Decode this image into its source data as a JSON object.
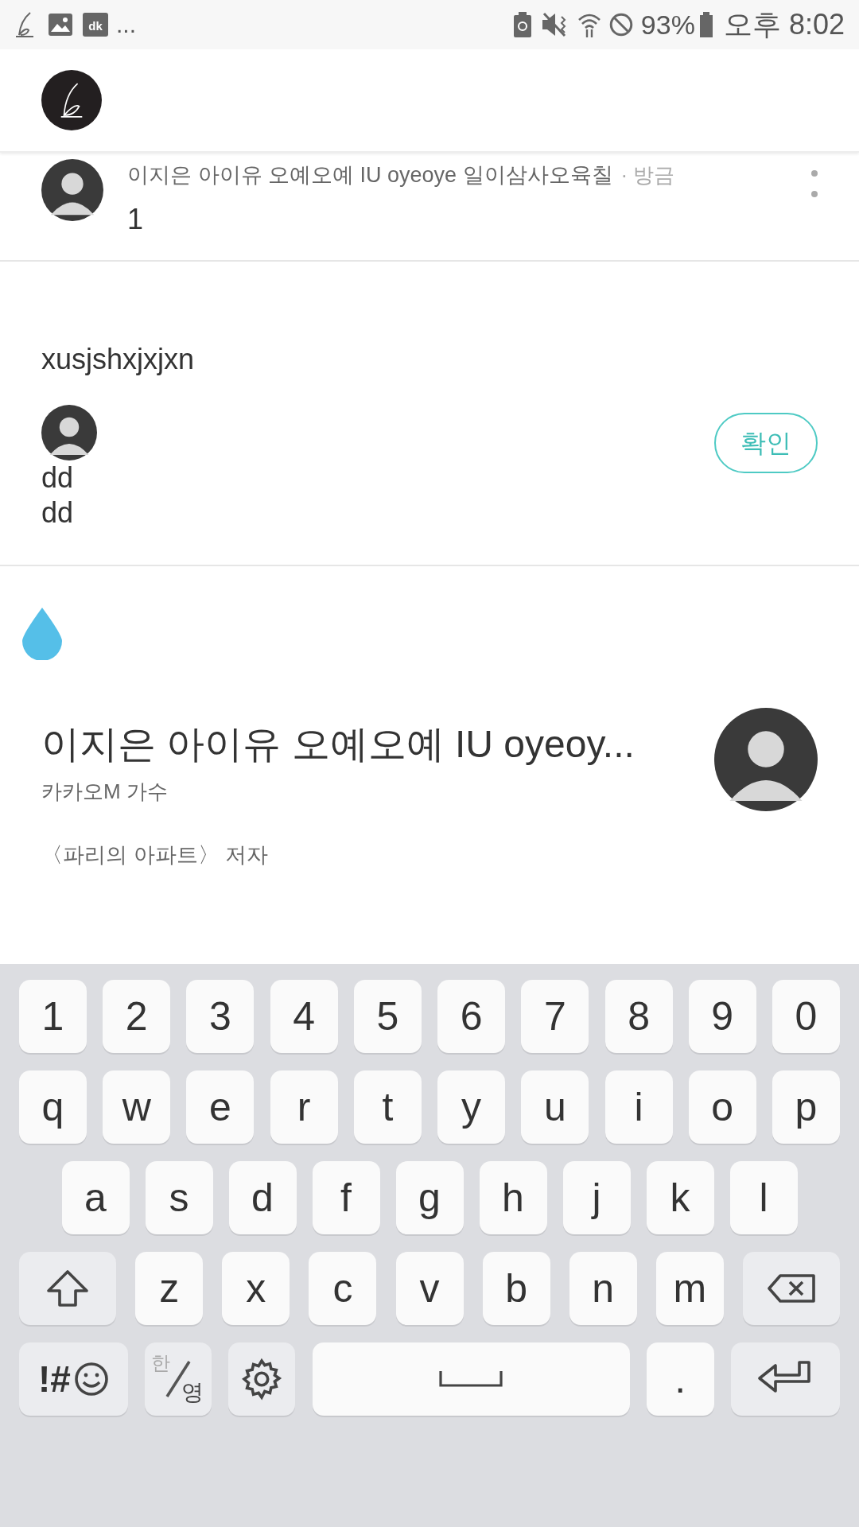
{
  "status_bar": {
    "notification_badge": "dk",
    "more": "...",
    "battery_percent": "93%",
    "time": "오후 8:02"
  },
  "comment": {
    "author": "이지은 아이유 오예오예 IU oyeoye 일이삼사오육칠",
    "time": "· 방금",
    "text": "1"
  },
  "draft": {
    "text": "xusjshxjxjxn"
  },
  "reply": {
    "lines": [
      "dd",
      "dd"
    ],
    "confirm": "확인"
  },
  "profile": {
    "name": "이지은 아이유 오예오예 IU oyeoy...",
    "subtitle": "카카오M 가수",
    "bio": "〈파리의 아파트〉 저자"
  },
  "keyboard": {
    "rows": [
      [
        {
          "kind": "char",
          "label": "1"
        },
        {
          "kind": "char",
          "label": "2"
        },
        {
          "kind": "char",
          "label": "3"
        },
        {
          "kind": "char",
          "label": "4"
        },
        {
          "kind": "char",
          "label": "5"
        },
        {
          "kind": "char",
          "label": "6"
        },
        {
          "kind": "char",
          "label": "7"
        },
        {
          "kind": "char",
          "label": "8"
        },
        {
          "kind": "char",
          "label": "9"
        },
        {
          "kind": "char",
          "label": "0"
        }
      ],
      [
        {
          "kind": "char",
          "label": "q"
        },
        {
          "kind": "char",
          "label": "w"
        },
        {
          "kind": "char",
          "label": "e"
        },
        {
          "kind": "char",
          "label": "r"
        },
        {
          "kind": "char",
          "label": "t"
        },
        {
          "kind": "char",
          "label": "y"
        },
        {
          "kind": "char",
          "label": "u"
        },
        {
          "kind": "char",
          "label": "i"
        },
        {
          "kind": "char",
          "label": "o"
        },
        {
          "kind": "char",
          "label": "p"
        }
      ],
      [
        {
          "kind": "char",
          "label": "a"
        },
        {
          "kind": "char",
          "label": "s"
        },
        {
          "kind": "char",
          "label": "d"
        },
        {
          "kind": "char",
          "label": "f"
        },
        {
          "kind": "char",
          "label": "g"
        },
        {
          "kind": "char",
          "label": "h"
        },
        {
          "kind": "char",
          "label": "j"
        },
        {
          "kind": "char",
          "label": "k"
        },
        {
          "kind": "char",
          "label": "l"
        }
      ],
      [
        {
          "kind": "shift"
        },
        {
          "kind": "char",
          "label": "z"
        },
        {
          "kind": "char",
          "label": "x"
        },
        {
          "kind": "char",
          "label": "c"
        },
        {
          "kind": "char",
          "label": "v"
        },
        {
          "kind": "char",
          "label": "b"
        },
        {
          "kind": "char",
          "label": "n"
        },
        {
          "kind": "char",
          "label": "m"
        },
        {
          "kind": "backspace"
        }
      ],
      [
        {
          "kind": "symbols",
          "label": "!#"
        },
        {
          "kind": "language",
          "label": "한",
          "label_2": "영"
        },
        {
          "kind": "settings"
        },
        {
          "kind": "space"
        },
        {
          "kind": "char",
          "label": "."
        },
        {
          "kind": "enter"
        }
      ]
    ]
  }
}
